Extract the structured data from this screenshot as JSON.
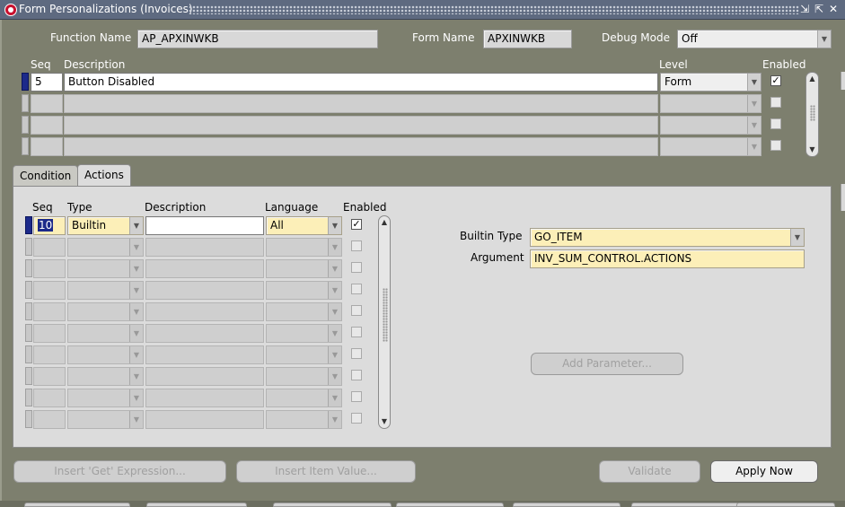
{
  "window": {
    "title": "Form Personalizations (Invoices)",
    "controls": [
      "⇲",
      "⇱",
      "✕"
    ]
  },
  "header": {
    "function_name_label": "Function Name",
    "function_name_value": "AP_APXINWKB",
    "form_name_label": "Form Name",
    "form_name_value": "APXINWKB",
    "debug_mode_label": "Debug Mode",
    "debug_mode_value": "Off"
  },
  "rules": {
    "columns": {
      "seq": "Seq",
      "description": "Description",
      "level": "Level",
      "enabled": "Enabled"
    },
    "rows": [
      {
        "seq": "5",
        "description": "Button Disabled",
        "level": "Form",
        "enabled": true
      },
      {
        "seq": "",
        "description": "",
        "level": "",
        "enabled": false
      },
      {
        "seq": "",
        "description": "",
        "level": "",
        "enabled": false
      },
      {
        "seq": "",
        "description": "",
        "level": "",
        "enabled": false
      }
    ]
  },
  "tabs": [
    {
      "label": "Condition",
      "active": false
    },
    {
      "label": "Actions",
      "active": true
    }
  ],
  "actions": {
    "columns": {
      "seq": "Seq",
      "type": "Type",
      "description": "Description",
      "language": "Language",
      "enabled": "Enabled"
    },
    "rows": [
      {
        "seq": "10",
        "type": "Builtin",
        "description": "",
        "language": "All",
        "enabled": true
      },
      {
        "seq": "",
        "type": "",
        "description": "",
        "language": "",
        "enabled": false
      },
      {
        "seq": "",
        "type": "",
        "description": "",
        "language": "",
        "enabled": false
      },
      {
        "seq": "",
        "type": "",
        "description": "",
        "language": "",
        "enabled": false
      },
      {
        "seq": "",
        "type": "",
        "description": "",
        "language": "",
        "enabled": false
      },
      {
        "seq": "",
        "type": "",
        "description": "",
        "language": "",
        "enabled": false
      },
      {
        "seq": "",
        "type": "",
        "description": "",
        "language": "",
        "enabled": false
      },
      {
        "seq": "",
        "type": "",
        "description": "",
        "language": "",
        "enabled": false
      },
      {
        "seq": "",
        "type": "",
        "description": "",
        "language": "",
        "enabled": false
      },
      {
        "seq": "",
        "type": "",
        "description": "",
        "language": "",
        "enabled": false
      }
    ],
    "builtin_type_label": "Builtin Type",
    "builtin_type_value": "GO_ITEM",
    "argument_label": "Argument",
    "argument_value": "INV_SUM_CONTROL.ACTIONS",
    "add_parameter_label": "Add Parameter..."
  },
  "footer": {
    "insert_get_expression_label": "Insert 'Get' Expression...",
    "insert_item_value_label": "Insert Item Value...",
    "validate_label": "Validate",
    "apply_now_label": "Apply Now"
  }
}
